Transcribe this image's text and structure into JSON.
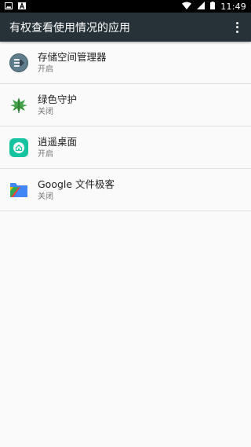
{
  "status_bar": {
    "time": "11:49",
    "left_icons": [
      "image-icon",
      "a-icon"
    ],
    "right_icons": [
      "wifi-icon",
      "signal-icon",
      "battery-icon"
    ]
  },
  "app_bar": {
    "title": "有权查看使用情况的应用",
    "menu_icon": "overflow-menu-icon",
    "background": "#263238"
  },
  "apps": [
    {
      "name": "存储空间管理器",
      "status": "开启",
      "icon": "storage-manager-icon"
    },
    {
      "name": "绿色守护",
      "status": "关闭",
      "icon": "greenify-leaf-icon"
    },
    {
      "name": "逍遥桌面",
      "status": "开启",
      "icon": "launcher-home-icon"
    },
    {
      "name": "Google 文件极客",
      "status": "关闭",
      "icon": "files-by-google-icon"
    }
  ]
}
